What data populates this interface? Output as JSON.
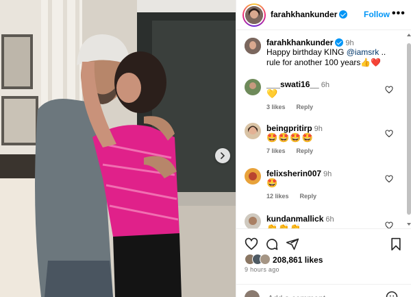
{
  "header": {
    "username": "farahkhankunder",
    "follow_label": "Follow",
    "more_label": "•••"
  },
  "caption": {
    "username": "farahkhankunder",
    "time": "9h",
    "text_before": "Happy birthday KING ",
    "mention": "@iamsrk",
    "text_after": " .. rule for another 100 years👍❤️"
  },
  "comments": [
    {
      "username": "___swati16__",
      "time": "6h",
      "text": "💛",
      "likes": "3 likes",
      "reply": "Reply"
    },
    {
      "username": "beingpritirp",
      "time": "9h",
      "text": "🤩🤩🤩🤩",
      "likes": "7 likes",
      "reply": "Reply"
    },
    {
      "username": "felixsherin007",
      "time": "9h",
      "text": "🤩",
      "likes": "12 likes",
      "reply": "Reply"
    },
    {
      "username": "kundanmallick",
      "time": "6h",
      "text": "👏👏👏",
      "likes": "",
      "reply": ""
    }
  ],
  "post": {
    "likes": "208,861 likes",
    "time_ago": "9 hours ago",
    "add_comment_placeholder": "Add a comment..."
  },
  "icons": {
    "like": "heart-icon",
    "comment": "comment-icon",
    "share": "share-icon",
    "save": "bookmark-icon",
    "next": "chevron-right-icon"
  },
  "colors": {
    "accent": "#0095f6",
    "mention": "#00376b",
    "muted": "#737373",
    "top_pink": "#e0218a"
  }
}
